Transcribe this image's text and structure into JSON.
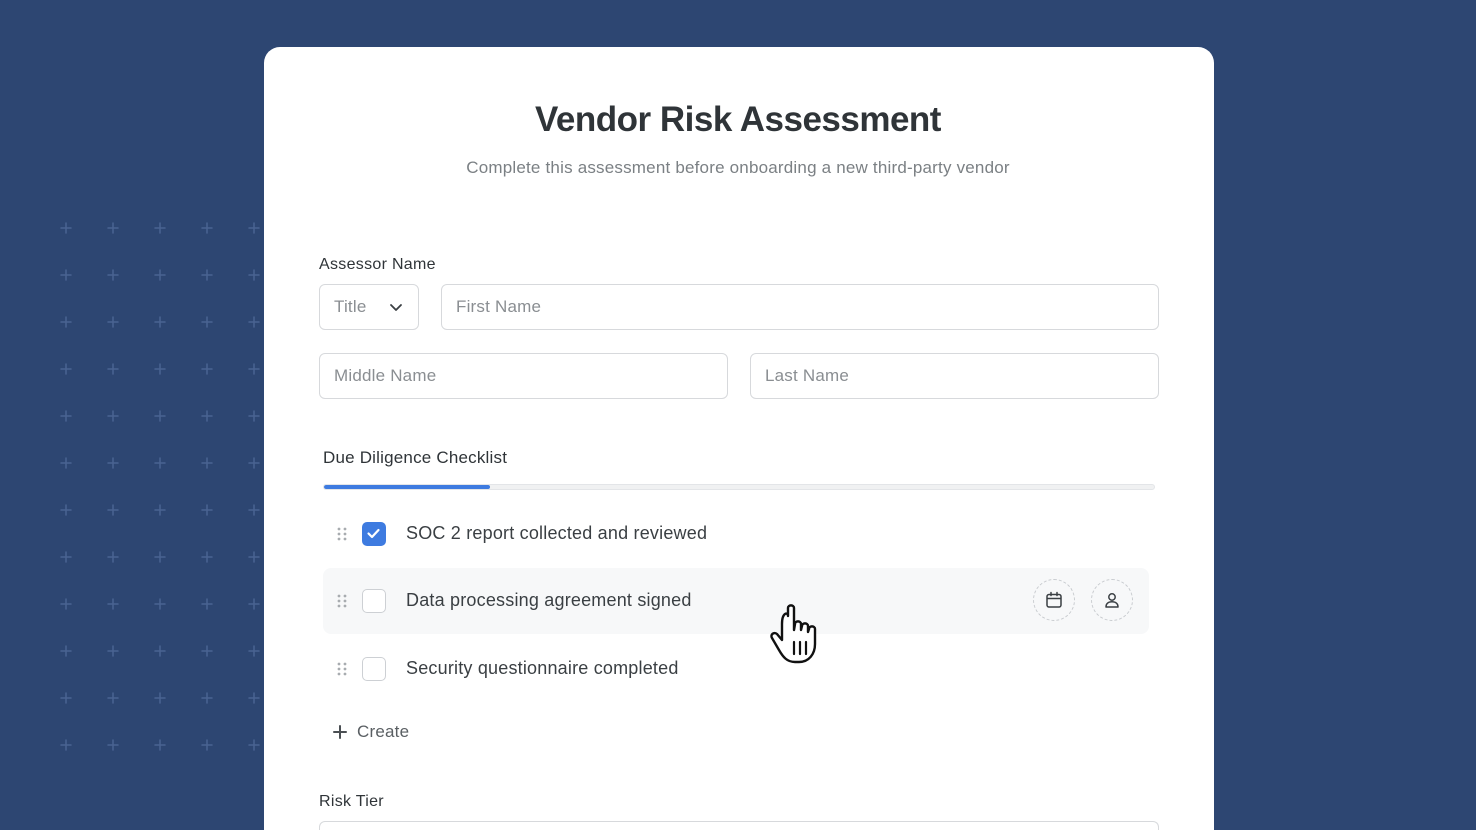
{
  "form": {
    "title": "Vendor Risk Assessment",
    "subtitle": "Complete this assessment before onboarding a new third-party vendor"
  },
  "assessor": {
    "label": "Assessor Name",
    "title_select": {
      "value": "Title"
    },
    "first_name": {
      "placeholder": "First Name"
    },
    "middle_name": {
      "placeholder": "Middle Name"
    },
    "last_name": {
      "placeholder": "Last Name"
    }
  },
  "checklist": {
    "label": "Due Diligence Checklist",
    "progress": 0.2,
    "items": [
      {
        "text": "SOC 2 report collected and reviewed",
        "checked": true
      },
      {
        "text": "Data processing agreement signed",
        "checked": false
      },
      {
        "text": "Security questionnaire completed",
        "checked": false
      }
    ],
    "create_label": "Create",
    "icons": {
      "drag": "drag-handle-icon",
      "check": "checkmark-icon",
      "date": "calendar-icon",
      "assignee": "user-icon",
      "create": "plus-icon",
      "cursor": "hand-pointer-icon"
    }
  },
  "risk_tier": {
    "label": "Risk Tier"
  },
  "colors": {
    "background": "#2d4672",
    "accent": "#3e7be0",
    "card": "#ffffff"
  }
}
